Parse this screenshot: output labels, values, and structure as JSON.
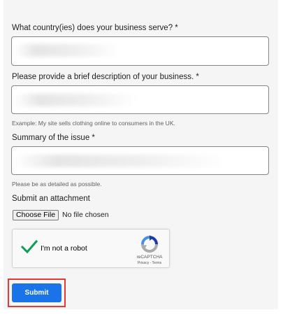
{
  "form": {
    "country_label": "What country(ies) does your business serve? *",
    "description_label": "Please provide a brief description of your business. *",
    "description_hint": "Example: My site sells clothing online to consumers in the UK.",
    "summary_label": "Summary of the issue *",
    "summary_hint": "Please be as detailed as possible.",
    "attachment_label": "Submit an attachment",
    "file_button_label": "Choose File",
    "file_status": "No file chosen",
    "recaptcha": {
      "label": "I'm not a robot",
      "brand": "reCAPTCHA",
      "links": "Privacy - Terms",
      "checked": true
    },
    "submit_label": "Submit"
  },
  "colors": {
    "accent": "#1a73e8",
    "highlight_border": "#e53935",
    "check_green": "#0f9d58"
  }
}
